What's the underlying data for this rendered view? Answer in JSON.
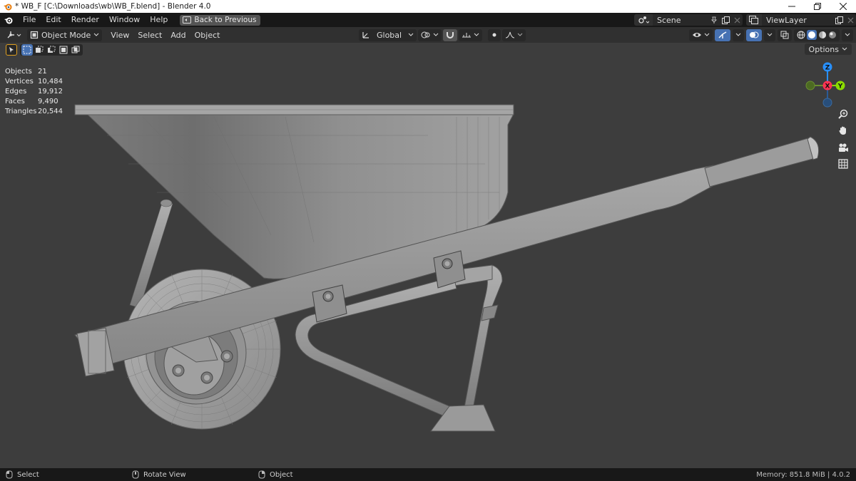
{
  "window": {
    "title": "* WB_F [C:\\Downloads\\wb\\WB_F.blend] - Blender 4.0",
    "controls": [
      "minimize",
      "restore",
      "close"
    ]
  },
  "topbar": {
    "menus": [
      "File",
      "Edit",
      "Render",
      "Window",
      "Help"
    ],
    "back_button": "Back to Previous",
    "scene_name": "Scene",
    "view_layer": "ViewLayer"
  },
  "viewport_header": {
    "mode": "Object Mode",
    "menus": [
      "View",
      "Select",
      "Add",
      "Object"
    ],
    "transform_orientation": "Global"
  },
  "tool_header": {
    "options_label": "Options"
  },
  "stats": [
    {
      "label": "Objects",
      "value": "21"
    },
    {
      "label": "Vertices",
      "value": "10,484"
    },
    {
      "label": "Edges",
      "value": "19,912"
    },
    {
      "label": "Faces",
      "value": "9,490"
    },
    {
      "label": "Triangles",
      "value": "20,544"
    }
  ],
  "gizmo": {
    "axes": [
      "Z",
      "X",
      "Y"
    ],
    "colors": {
      "x": "#ff3352",
      "y": "#8bdc00",
      "z": "#2890ff"
    }
  },
  "statusbar": {
    "select": "Select",
    "rotate": "Rotate View",
    "object": "Object",
    "memory": "Memory: 851.8 MiB | 4.0.2"
  },
  "colors": {
    "accent": "#4772b3",
    "viewport_bg": "#3d3d3d",
    "header_bg": "#303030",
    "topbar_bg": "#181818"
  }
}
